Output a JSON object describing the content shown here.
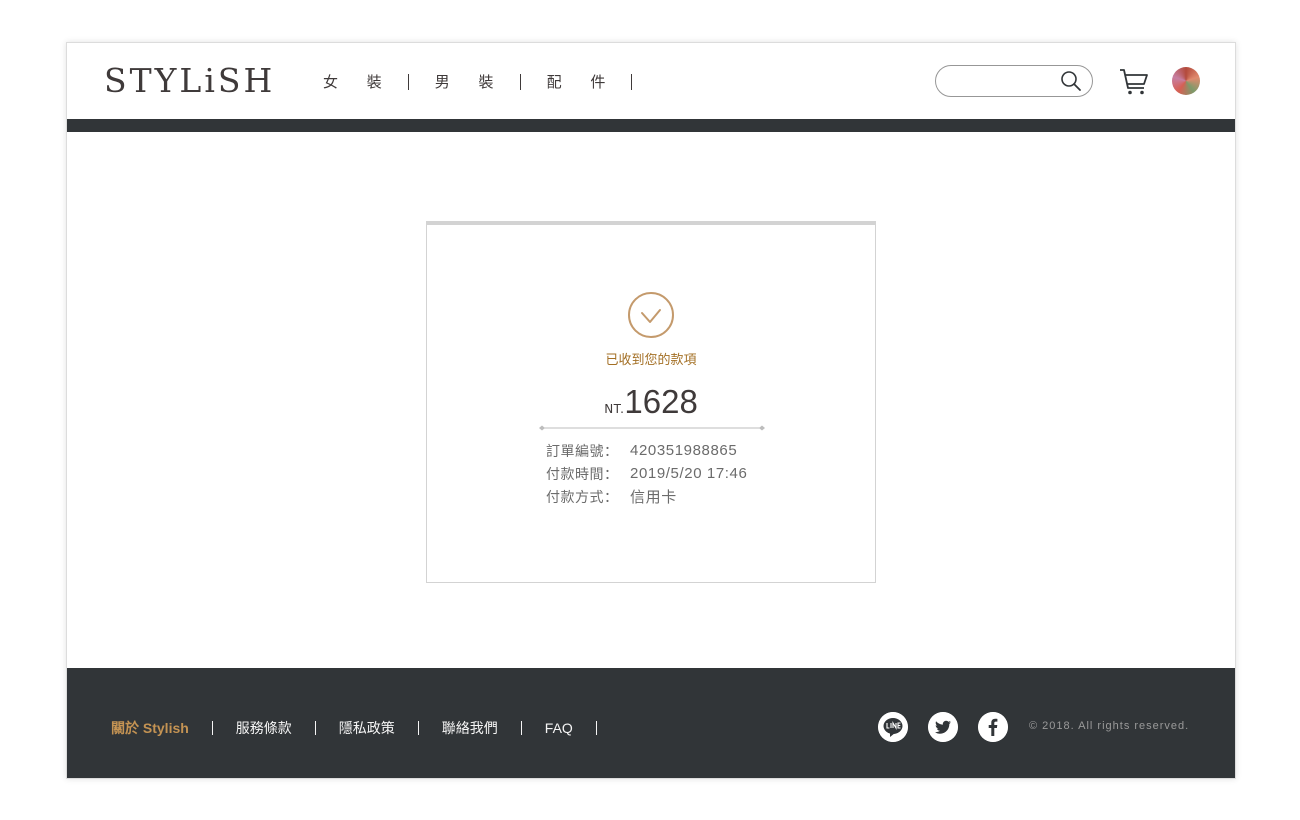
{
  "header": {
    "logo": "STYLiSH",
    "nav": [
      {
        "label": "女 裝"
      },
      {
        "label": "男 裝"
      },
      {
        "label": "配 件"
      }
    ],
    "search": {
      "value": "",
      "placeholder": ""
    },
    "icons": {
      "search": "search-icon",
      "cart": "cart-icon",
      "avatar": "avatar"
    }
  },
  "order": {
    "status_text": "已收到您的款項",
    "currency_prefix": "NT.",
    "amount": "1628",
    "details": [
      {
        "label": "訂單編號：",
        "value": "420351988865"
      },
      {
        "label": "付款時間：",
        "value": "2019/5/20 17:46"
      },
      {
        "label": "付款方式：",
        "value": "信用卡"
      }
    ],
    "accent_color": "#a36f24"
  },
  "footer": {
    "links": [
      {
        "label": "關於 Stylish"
      },
      {
        "label": "服務條款"
      },
      {
        "label": "隱私政策"
      },
      {
        "label": "聯絡我們"
      },
      {
        "label": "FAQ"
      }
    ],
    "social": [
      "line-icon",
      "twitter-icon",
      "facebook-icon"
    ],
    "copyright": "© 2018. All rights reserved.",
    "active_color": "#c49353",
    "background": "#313538"
  }
}
